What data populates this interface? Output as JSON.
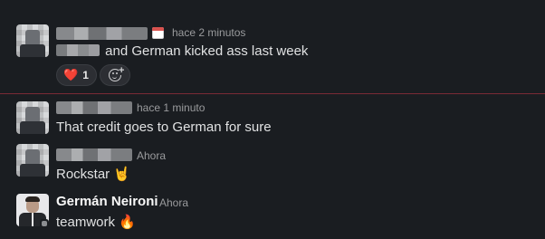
{
  "messages": [
    {
      "author_blurred": true,
      "time": "hace 2 minutos",
      "status_icon": "calendar-icon",
      "text_suffix": " and German kicked ass last week",
      "reactions": [
        {
          "emoji": "❤️",
          "count": "1"
        }
      ]
    },
    {
      "author_blurred": true,
      "time": "hace 1 minuto",
      "text": "That credit goes to German for sure"
    },
    {
      "author_blurred": true,
      "time": "Ahora",
      "text": "Rockstar 🤘"
    },
    {
      "author": "Germán Neironi",
      "time": "Ahora",
      "text": "teamwork 🔥"
    }
  ],
  "colors": {
    "background": "#1a1d21",
    "divider": "#7a2a35"
  }
}
